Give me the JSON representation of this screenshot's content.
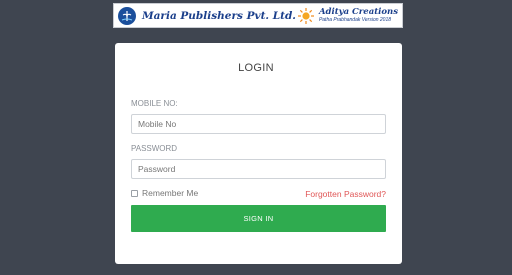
{
  "banner": {
    "publisher_name": "Maria Publishers Pvt. Ltd.",
    "partner_name": "Aditya Creations",
    "partner_tagline": "Patha Prabhandak Version 2018"
  },
  "login": {
    "title": "LOGIN",
    "mobile_label": "MOBILE NO:",
    "mobile_placeholder": "Mobile No",
    "mobile_value": "",
    "password_label": "PASSWORD",
    "password_placeholder": "Password",
    "password_value": "",
    "remember_label": "Remember Me",
    "remember_checked": false,
    "forgot_label": "Forgotten Password?",
    "signin_label": "SIGN IN"
  },
  "colors": {
    "page_background": "#3f4550",
    "signin_button": "#2fab4f",
    "forgot_link": "#e05656",
    "brand_blue": "#1b3f8b"
  },
  "icons": {
    "publisher_logo": "maria-logo-icon",
    "partner_logo": "sun-logo-icon"
  }
}
